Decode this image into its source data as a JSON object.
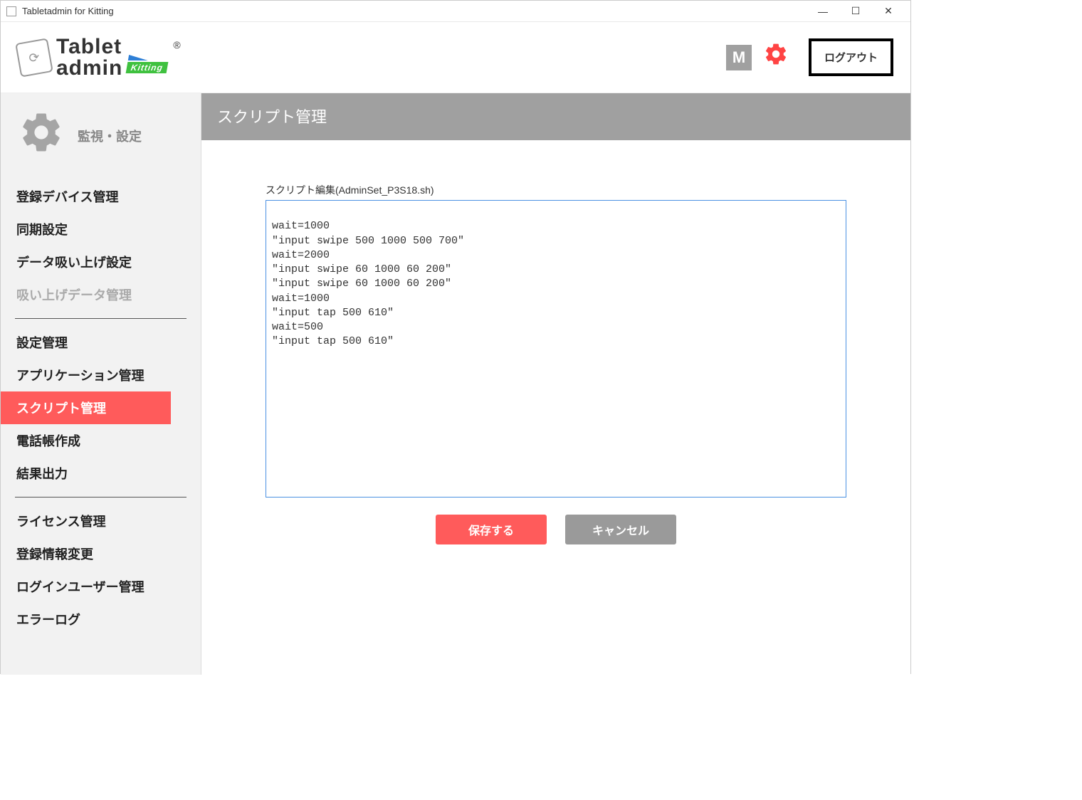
{
  "window": {
    "title": "Tabletadmin for Kitting"
  },
  "logo": {
    "line1": "Tablet",
    "line2": "admin",
    "kitting": "Kitting",
    "reg": "®"
  },
  "header": {
    "m_badge": "M",
    "logout": "ログアウト"
  },
  "sidebar": {
    "head_label": "監視・設定",
    "group1": [
      {
        "label": "登録デバイス管理",
        "active": false,
        "disabled": false
      },
      {
        "label": "同期設定",
        "active": false,
        "disabled": false
      },
      {
        "label": "データ吸い上げ設定",
        "active": false,
        "disabled": false
      },
      {
        "label": "吸い上げデータ管理",
        "active": false,
        "disabled": true
      }
    ],
    "group2": [
      {
        "label": "設定管理",
        "active": false,
        "disabled": false
      },
      {
        "label": "アプリケーション管理",
        "active": false,
        "disabled": false
      },
      {
        "label": "スクリプト管理",
        "active": true,
        "disabled": false
      },
      {
        "label": "電話帳作成",
        "active": false,
        "disabled": false
      },
      {
        "label": "結果出力",
        "active": false,
        "disabled": false
      }
    ],
    "group3": [
      {
        "label": "ライセンス管理",
        "active": false,
        "disabled": false
      },
      {
        "label": "登録情報変更",
        "active": false,
        "disabled": false
      },
      {
        "label": "ログインユーザー管理",
        "active": false,
        "disabled": false
      },
      {
        "label": "エラーログ",
        "active": false,
        "disabled": false
      }
    ]
  },
  "main": {
    "title": "スクリプト管理",
    "editor_label": "スクリプト編集(AdminSet_P3S18.sh)",
    "editor_content": "\nwait=1000\n\"input swipe 500 1000 500 700\"\nwait=2000\n\"input swipe 60 1000 60 200\"\n\"input swipe 60 1000 60 200\"\nwait=1000\n\"input tap 500 610\"\nwait=500\n\"input tap 500 610\"",
    "save": "保存する",
    "cancel": "キャンセル"
  }
}
